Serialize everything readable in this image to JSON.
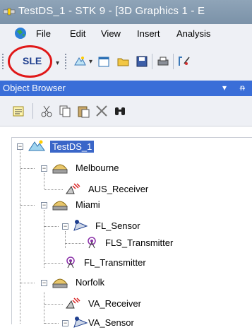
{
  "window": {
    "title": "TestDS_1 - STK 9 - [3D Graphics 1 - E"
  },
  "menu": {
    "items": [
      "File",
      "Edit",
      "View",
      "Insert",
      "Analysis"
    ]
  },
  "toolbar": {
    "sle_label": "SLE"
  },
  "panel": {
    "title": "Object Browser",
    "dropdown_icon": "▾",
    "pin_icon": "ᵰ"
  },
  "tree": {
    "root": "TestDS_1",
    "nodes": [
      {
        "label": "Melbourne"
      },
      {
        "label": "AUS_Receiver"
      },
      {
        "label": "Miami"
      },
      {
        "label": "FL_Sensor"
      },
      {
        "label": "FLS_Transmitter"
      },
      {
        "label": "FL_Transmitter"
      },
      {
        "label": "Norfolk"
      },
      {
        "label": "VA_Receiver"
      },
      {
        "label": "VA_Sensor"
      }
    ]
  },
  "colors": {
    "selection": "#3a66c8",
    "circle": "#e01818",
    "panel_header": "#3a6ed8"
  }
}
